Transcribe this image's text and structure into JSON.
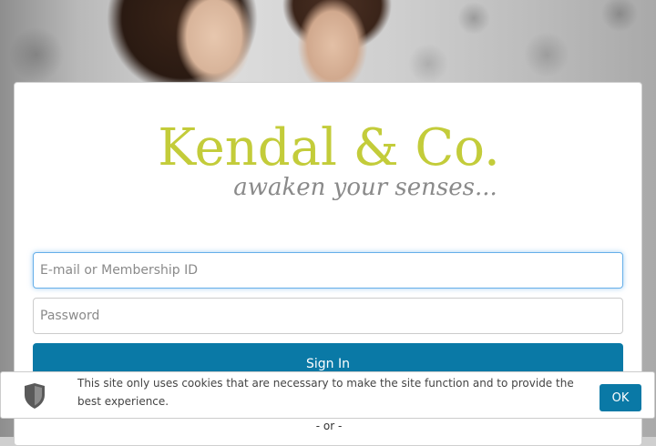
{
  "brand": {
    "name": "Kendal & Co.",
    "tagline": "awaken your senses...",
    "logo_color": "#c3cc3a"
  },
  "login": {
    "email_placeholder": "E-mail or Membership ID",
    "password_placeholder": "Password",
    "sign_in_label": "Sign In",
    "separator": "- or -"
  },
  "cookie_banner": {
    "icon": "shield-icon",
    "message": "This site only uses cookies that are necessary to make the site function and to provide the best experience.",
    "ok_label": "OK"
  },
  "colors": {
    "primary": "#0a79a6",
    "focus": "#66afe9"
  }
}
